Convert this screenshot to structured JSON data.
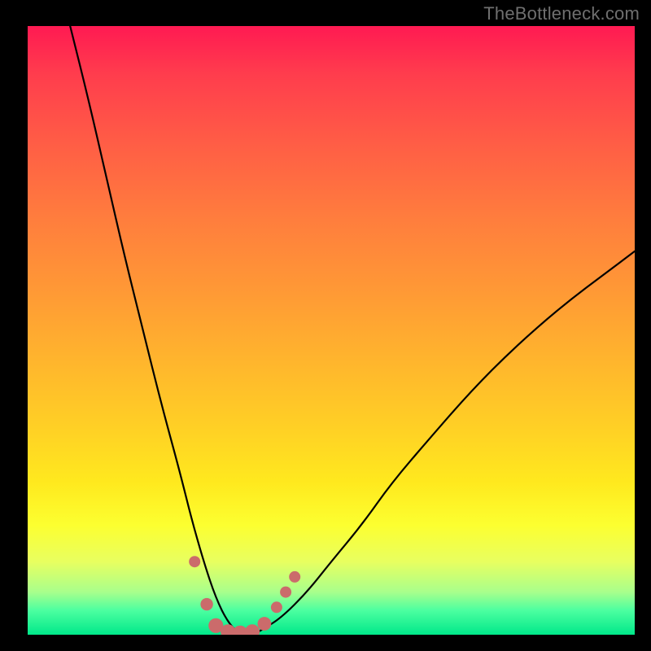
{
  "watermark": "TheBottleneck.com",
  "chart_data": {
    "type": "line",
    "title": "",
    "xlabel": "",
    "ylabel": "",
    "xlim": [
      0,
      100
    ],
    "ylim": [
      0,
      100
    ],
    "grid": false,
    "legend": false,
    "background_gradient": {
      "direction": "vertical",
      "stops": [
        {
          "pos": 0.0,
          "color": "#ff1a52"
        },
        {
          "pos": 0.3,
          "color": "#ff7a3e"
        },
        {
          "pos": 0.6,
          "color": "#ffc828"
        },
        {
          "pos": 0.82,
          "color": "#fcff30"
        },
        {
          "pos": 1.0,
          "color": "#00e88a"
        }
      ]
    },
    "series": [
      {
        "name": "bottleneck-curve",
        "x": [
          7,
          10,
          13,
          16,
          19,
          22,
          25,
          27,
          29,
          31,
          33,
          35,
          37,
          39,
          42,
          46,
          50,
          55,
          60,
          66,
          73,
          80,
          88,
          96,
          100
        ],
        "y": [
          100,
          88,
          75,
          62,
          50,
          38,
          27,
          19,
          12,
          6,
          2,
          0,
          0,
          1,
          3,
          7,
          12,
          18,
          25,
          32,
          40,
          47,
          54,
          60,
          63
        ]
      }
    ],
    "markers": {
      "name": "highlight-dots",
      "color": "#cb6b6b",
      "points": [
        {
          "x": 27.5,
          "y": 12.0,
          "r": 1.0
        },
        {
          "x": 29.5,
          "y": 5.0,
          "r": 1.1
        },
        {
          "x": 31.0,
          "y": 1.5,
          "r": 1.3
        },
        {
          "x": 33.0,
          "y": 0.5,
          "r": 1.3
        },
        {
          "x": 35.0,
          "y": 0.3,
          "r": 1.3
        },
        {
          "x": 37.0,
          "y": 0.5,
          "r": 1.3
        },
        {
          "x": 39.0,
          "y": 1.8,
          "r": 1.2
        },
        {
          "x": 41.0,
          "y": 4.5,
          "r": 1.0
        },
        {
          "x": 42.5,
          "y": 7.0,
          "r": 1.0
        },
        {
          "x": 44.0,
          "y": 9.5,
          "r": 1.0
        }
      ]
    }
  }
}
